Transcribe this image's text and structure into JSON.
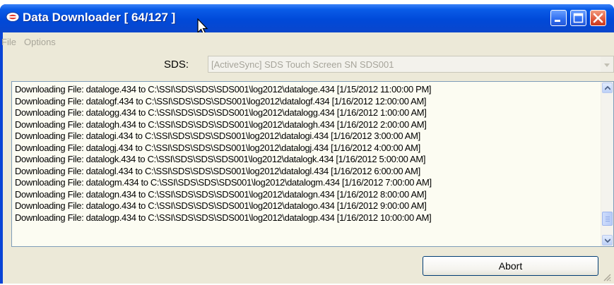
{
  "window": {
    "title": "Data Downloader [ 64/127 ]"
  },
  "menu": [
    {
      "label": "File"
    },
    {
      "label": "Options"
    }
  ],
  "sds": {
    "label": "SDS:",
    "selected": "[ActiveSync] SDS Touch Screen SN SDS001"
  },
  "log": {
    "lines": [
      "Downloading File: dataloge.434 to C:\\SSI\\SDS\\SDS\\SDS001\\log2012\\dataloge.434 [1/15/2012 11:00:00 PM]",
      "Downloading File: datalogf.434 to C:\\SSI\\SDS\\SDS\\SDS001\\log2012\\datalogf.434 [1/16/2012 12:00:00 AM]",
      "Downloading File: datalogg.434 to C:\\SSI\\SDS\\SDS\\SDS001\\log2012\\datalogg.434 [1/16/2012 1:00:00 AM]",
      "Downloading File: datalogh.434 to C:\\SSI\\SDS\\SDS\\SDS001\\log2012\\datalogh.434 [1/16/2012 2:00:00 AM]",
      "Downloading File: datalogi.434 to C:\\SSI\\SDS\\SDS\\SDS001\\log2012\\datalogi.434 [1/16/2012 3:00:00 AM]",
      "Downloading File: datalogj.434 to C:\\SSI\\SDS\\SDS\\SDS001\\log2012\\datalogj.434 [1/16/2012 4:00:00 AM]",
      "Downloading File: datalogk.434 to C:\\SSI\\SDS\\SDS\\SDS001\\log2012\\datalogk.434 [1/16/2012 5:00:00 AM]",
      "Downloading File: datalogl.434 to C:\\SSI\\SDS\\SDS\\SDS001\\log2012\\datalogl.434 [1/16/2012 6:00:00 AM]",
      "Downloading File: datalogm.434 to C:\\SSI\\SDS\\SDS\\SDS001\\log2012\\datalogm.434 [1/16/2012 7:00:00 AM]",
      "Downloading File: datalogn.434 to C:\\SSI\\SDS\\SDS\\SDS001\\log2012\\datalogn.434 [1/16/2012 8:00:00 AM]",
      "Downloading File: datalogo.434 to C:\\SSI\\SDS\\SDS\\SDS001\\log2012\\datalogo.434 [1/16/2012 9:00:00 AM]",
      "Downloading File: datalogp.434 to C:\\SSI\\SDS\\SDS\\SDS001\\log2012\\datalogp.434 [1/16/2012 10:00:00 AM]"
    ]
  },
  "buttons": {
    "abort": "Abort"
  },
  "icons": {
    "app": "ssi-logo-icon",
    "minimize": "minimize-icon",
    "maximize": "maximize-icon",
    "close": "close-icon",
    "cursor": "mouse-cursor-icon"
  },
  "colors": {
    "titlebar": "#0a5ce8",
    "client": "#ece9d8",
    "close": "#e0573a"
  }
}
